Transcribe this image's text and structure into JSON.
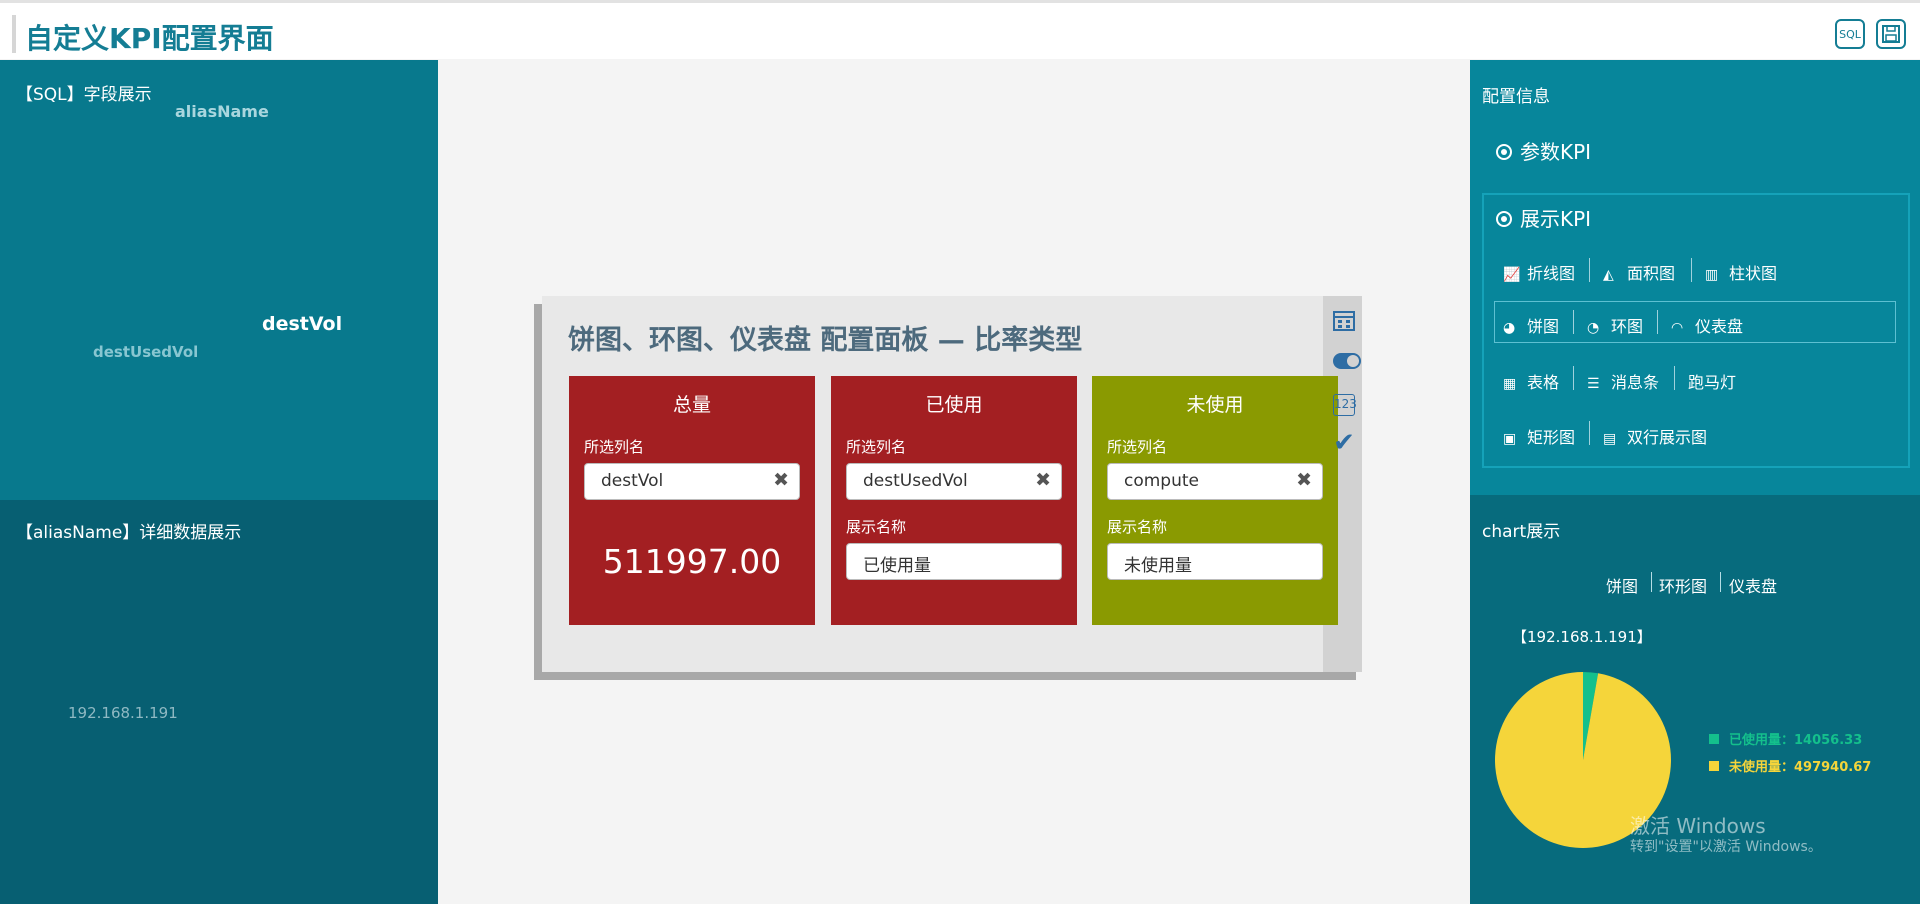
{
  "header": {
    "title": "自定义KPI配置界面",
    "sql_icon_text": "SQL"
  },
  "left_top": {
    "title": "【SQL】字段展示",
    "fields": [
      "aliasName",
      "destVol",
      "destUsedVol"
    ]
  },
  "left_bottom": {
    "title": "【aliasName】详细数据展示",
    "value": "192.168.1.191"
  },
  "panel": {
    "title": "饼图、环图、仪表盘 配置面板 — 比率类型",
    "cards": [
      {
        "title": "总量",
        "col_label": "所选列名",
        "col_value": "destVol",
        "big_value": "511997.00",
        "color": "#a31f22"
      },
      {
        "title": "已使用",
        "col_label": "所选列名",
        "col_value": "destUsedVol",
        "name_label": "展示名称",
        "name_value": "已使用量",
        "color": "#a31f22"
      },
      {
        "title": "未使用",
        "col_label": "所选列名",
        "col_value": "compute",
        "name_label": "展示名称",
        "name_value": "未使用量",
        "color": "#8a9a01"
      }
    ],
    "side_icons": [
      "calendar-icon",
      "toggle-icon",
      "number-123-icon",
      "check-icon"
    ],
    "side_icon_123_text": "123"
  },
  "config": {
    "title": "配置信息",
    "param_kpi": "参数KPI",
    "show_kpi": "展示KPI",
    "charts_row1": [
      "折线图",
      "面积图",
      "柱状图"
    ],
    "charts_row2": [
      "饼图",
      "环图",
      "仪表盘"
    ],
    "charts_row3": [
      "表格",
      "消息条",
      "跑马灯"
    ],
    "charts_row4": [
      "矩形图",
      "双行展示图"
    ]
  },
  "chart_panel": {
    "title": "chart展示",
    "tabs": [
      "饼图",
      "环形图",
      "仪表盘"
    ],
    "ip_label": "【192.168.1.191】"
  },
  "chart_data": {
    "type": "pie",
    "title": "【192.168.1.191】",
    "labels": [
      "已使用量",
      "未使用量"
    ],
    "values": [
      14056.33,
      497940.67
    ],
    "colors": [
      "#14c08c",
      "#f5d53a"
    ],
    "legend_texts": [
      "已使用量：14056.33",
      "未使用量：497940.67"
    ],
    "legend": "right"
  },
  "watermark": {
    "line1": "激活 Windows",
    "line2": "转到\"设置\"以激活 Windows。"
  },
  "colors": {
    "brand": "#147d94",
    "red_card": "#a31f22",
    "green_card": "#8a9a01",
    "used": "#14c08c",
    "unused": "#f5d53a"
  }
}
